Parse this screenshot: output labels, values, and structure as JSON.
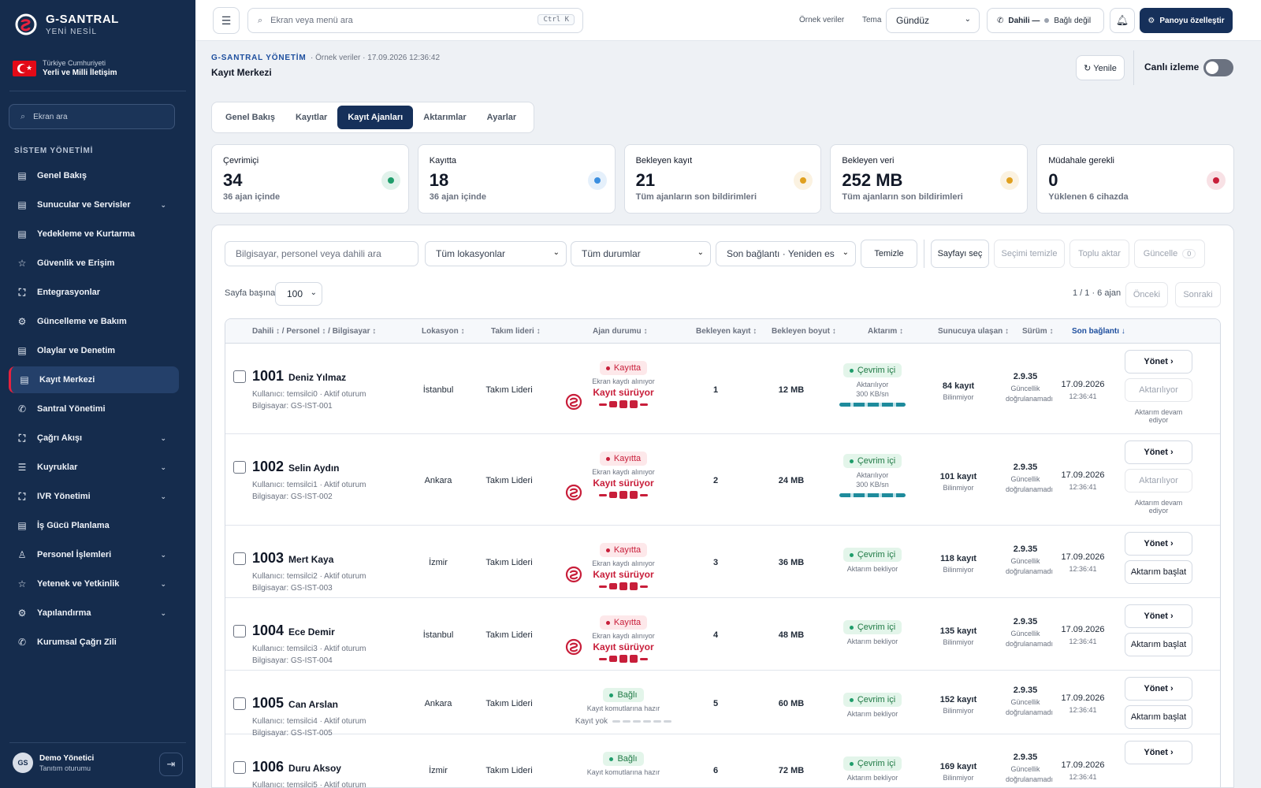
{
  "brand": {
    "name": "G-SANTRAL",
    "sub": "YENİ NESİL",
    "flag_line1": "Türkiye Cumhuriyeti",
    "flag_line2": "Yerli ve Milli İletişim"
  },
  "sidebar": {
    "search_placeholder": "Ekran ara",
    "section_title": "SİSTEM YÖNETİMİ",
    "items": [
      {
        "label": "Genel Bakış",
        "icon": "dashboard-icon",
        "chevron": false
      },
      {
        "label": "Sunucular ve Servisler",
        "icon": "server-icon",
        "chevron": true
      },
      {
        "label": "Yedekleme ve Kurtarma",
        "icon": "backup-icon",
        "chevron": false
      },
      {
        "label": "Güvenlik ve Erişim",
        "icon": "star-icon",
        "chevron": false
      },
      {
        "label": "Entegrasyonlar",
        "icon": "integration-icon",
        "chevron": false
      },
      {
        "label": "Güncelleme ve Bakım",
        "icon": "gear-icon",
        "chevron": false
      },
      {
        "label": "Olaylar ve Denetim",
        "icon": "audit-icon",
        "chevron": false
      },
      {
        "label": "Kayıt Merkezi",
        "icon": "record-icon",
        "chevron": false,
        "active": true
      },
      {
        "label": "Santral Yönetimi",
        "icon": "phone-icon",
        "chevron": false
      },
      {
        "label": "Çağrı Akışı",
        "icon": "flow-icon",
        "chevron": true
      },
      {
        "label": "Kuyruklar",
        "icon": "queue-icon",
        "chevron": true
      },
      {
        "label": "IVR Yönetimi",
        "icon": "ivr-icon",
        "chevron": true
      },
      {
        "label": "İş Gücü Planlama",
        "icon": "planning-icon",
        "chevron": false
      },
      {
        "label": "Personel İşlemleri",
        "icon": "person-icon",
        "chevron": true
      },
      {
        "label": "Yetenek ve Yetkinlik",
        "icon": "star-icon",
        "chevron": true
      },
      {
        "label": "Yapılandırma",
        "icon": "gear-icon",
        "chevron": true
      },
      {
        "label": "Kurumsal Çağrı Zili",
        "icon": "phone-icon",
        "chevron": false
      }
    ],
    "user": {
      "initials": "GS",
      "name": "Demo Yönetici",
      "session": "Tanıtım oturumu"
    }
  },
  "topbar": {
    "search_placeholder": "Ekran veya menü ara",
    "shortcut": "Ctrl K",
    "sample_data": "Örnek veriler",
    "theme_label": "Tema",
    "theme_value": "Gündüz",
    "dahili_label": "Dahili —",
    "dahili_status": "Bağlı değil",
    "customize": "Panoyu özelleştir"
  },
  "header": {
    "crumb_brand": "G-SANTRAL YÖNETİM",
    "crumb_rest": "· Örnek veriler · 17.09.2026 12:36:42",
    "title": "Kayıt Merkezi",
    "refresh": "↻ Yenile",
    "live_label": "Canlı izleme",
    "live_on": false
  },
  "tabs": [
    {
      "label": "Genel Bakış"
    },
    {
      "label": "Kayıtlar"
    },
    {
      "label": "Kayıt Ajanları",
      "active": true
    },
    {
      "label": "Aktarımlar"
    },
    {
      "label": "Ayarlar"
    }
  ],
  "stats": [
    {
      "label": "Çevrimiçi",
      "value": "34",
      "sub": "36 ajan içinde",
      "color": "#1f9d6b"
    },
    {
      "label": "Kayıtta",
      "value": "18",
      "sub": "36 ajan içinde",
      "color": "#3b8fe0"
    },
    {
      "label": "Bekleyen kayıt",
      "value": "21",
      "sub": "Tüm ajanların son bildirimleri",
      "color": "#e0a01f"
    },
    {
      "label": "Bekleyen veri",
      "value": "252 MB",
      "sub": "Tüm ajanların son bildirimleri",
      "color": "#e0a01f"
    },
    {
      "label": "Müdahale gerekli",
      "value": "0",
      "sub": "Yüklenen 6 cihazda",
      "color": "#c81e3a"
    }
  ],
  "filters": {
    "search_placeholder": "Bilgisayar, personel veya dahili ara",
    "location": "Tüm lokasyonlar",
    "status": "Tüm durumlar",
    "sort": "Son bağlantı · Yeniden es",
    "clear": "Temizle",
    "select_page": "Sayfayı seç",
    "clear_selection": "Seçimi temizle",
    "bulk_transfer": "Toplu aktar",
    "update": "Güncelle",
    "update_count": "0",
    "per_page_label": "Sayfa başına",
    "per_page": "100",
    "count": "1 / 1 · 6 ajan",
    "prev": "Önceki",
    "next": "Sonraki"
  },
  "columns": {
    "dahili": "Dahili ↕ / Personel ↕ / Bilgisayar ↕",
    "lokasyon": "Lokasyon ↕",
    "takim": "Takım lideri ↕",
    "ajan": "Ajan durumu ↕",
    "bekleyen_kayit": "Bekleyen kayıt ↕",
    "bekleyen_boyut": "Bekleyen boyut ↕",
    "aktarim": "Aktarım ↕",
    "sunucu": "Sunucuya ulaşan ↕",
    "surum": "Sürüm ↕",
    "son": "Son bağlantı ↓"
  },
  "rows": [
    {
      "ext": "1001",
      "name": "Deniz Yılmaz",
      "user": "Kullanıcı: temsilci0 · Aktif oturum",
      "pc": "Bilgisayar: GS-IST-001",
      "location": "İstanbul",
      "lead": "Takım Lideri",
      "agent_pill": "Kayıtta",
      "agent_note": "Ekran kaydı alınıyor",
      "rec_text": "Kayıt sürüyor",
      "recording": true,
      "pending": "1",
      "size": "12 MB",
      "transfer": "Çevrim içi",
      "transfer_note": "Aktarılıyor",
      "speed": "300 KB/sn",
      "transferring": true,
      "server": "84 kayıt",
      "server_note": "Bilinmiyor",
      "version": "2.9.35",
      "version_note": "Güncellik doğrulanamadı",
      "date": "17.09.2026",
      "time": "12:36:41",
      "manage": "Yönet ›",
      "second": "Aktarılıyor",
      "second_disabled": true,
      "note": "Aktarım devam ediyor"
    },
    {
      "ext": "1002",
      "name": "Selin Aydın",
      "user": "Kullanıcı: temsilci1 · Aktif oturum",
      "pc": "Bilgisayar: GS-IST-002",
      "location": "Ankara",
      "lead": "Takım Lideri",
      "agent_pill": "Kayıtta",
      "agent_note": "Ekran kaydı alınıyor",
      "rec_text": "Kayıt sürüyor",
      "recording": true,
      "pending": "2",
      "size": "24 MB",
      "transfer": "Çevrim içi",
      "transfer_note": "Aktarılıyor",
      "speed": "300 KB/sn",
      "transferring": true,
      "server": "101 kayıt",
      "server_note": "Bilinmiyor",
      "version": "2.9.35",
      "version_note": "Güncellik doğrulanamadı",
      "date": "17.09.2026",
      "time": "12:36:41",
      "manage": "Yönet ›",
      "second": "Aktarılıyor",
      "second_disabled": true,
      "note": "Aktarım devam ediyor"
    },
    {
      "ext": "1003",
      "name": "Mert Kaya",
      "user": "Kullanıcı: temsilci2 · Aktif oturum",
      "pc": "Bilgisayar: GS-IST-003",
      "location": "İzmir",
      "lead": "Takım Lideri",
      "agent_pill": "Kayıtta",
      "agent_note": "Ekran kaydı alınıyor",
      "rec_text": "Kayıt sürüyor",
      "recording": true,
      "pending": "3",
      "size": "36 MB",
      "transfer": "Çevrim içi",
      "transfer_note": "Aktarım bekliyor",
      "speed": "",
      "transferring": false,
      "server": "118 kayıt",
      "server_note": "Bilinmiyor",
      "version": "2.9.35",
      "version_note": "Güncellik doğrulanamadı",
      "date": "17.09.2026",
      "time": "12:36:41",
      "manage": "Yönet ›",
      "second": "Aktarım başlat",
      "second_disabled": false,
      "note": ""
    },
    {
      "ext": "1004",
      "name": "Ece Demir",
      "user": "Kullanıcı: temsilci3 · Aktif oturum",
      "pc": "Bilgisayar: GS-IST-004",
      "location": "İstanbul",
      "lead": "Takım Lideri",
      "agent_pill": "Kayıtta",
      "agent_note": "Ekran kaydı alınıyor",
      "rec_text": "Kayıt sürüyor",
      "recording": true,
      "pending": "4",
      "size": "48 MB",
      "transfer": "Çevrim içi",
      "transfer_note": "Aktarım bekliyor",
      "speed": "",
      "transferring": false,
      "server": "135 kayıt",
      "server_note": "Bilinmiyor",
      "version": "2.9.35",
      "version_note": "Güncellik doğrulanamadı",
      "date": "17.09.2026",
      "time": "12:36:41",
      "manage": "Yönet ›",
      "second": "Aktarım başlat",
      "second_disabled": false,
      "note": ""
    },
    {
      "ext": "1005",
      "name": "Can Arslan",
      "user": "Kullanıcı: temsilci4 · Aktif oturum",
      "pc": "Bilgisayar: GS-IST-005",
      "location": "Ankara",
      "lead": "Takım Lideri",
      "agent_pill": "Bağlı",
      "agent_note": "Kayıt komutlarına hazır",
      "rec_text": "Kayıt yok",
      "recording": false,
      "pending": "5",
      "size": "60 MB",
      "transfer": "Çevrim içi",
      "transfer_note": "Aktarım bekliyor",
      "speed": "",
      "transferring": false,
      "server": "152 kayıt",
      "server_note": "Bilinmiyor",
      "version": "2.9.35",
      "version_note": "Güncellik doğrulanamadı",
      "date": "17.09.2026",
      "time": "12:36:41",
      "manage": "Yönet ›",
      "second": "Aktarım başlat",
      "second_disabled": false,
      "note": ""
    },
    {
      "ext": "1006",
      "name": "Duru Aksoy",
      "user": "Kullanıcı: temsilci5 · Aktif oturum",
      "pc": "",
      "location": "İzmir",
      "lead": "Takım Lideri",
      "agent_pill": "Bağlı",
      "agent_note": "Kayıt komutlarına hazır",
      "rec_text": "",
      "recording": false,
      "pending": "6",
      "size": "72 MB",
      "transfer": "Çevrim içi",
      "transfer_note": "Aktarım bekliyor",
      "speed": "",
      "transferring": false,
      "server": "169 kayıt",
      "server_note": "Bilinmiyor",
      "version": "2.9.35",
      "version_note": "Güncellik doğrulanamadı",
      "date": "17.09.2026",
      "time": "12:36:41",
      "manage": "Yönet ›",
      "second": "",
      "second_disabled": false,
      "note": ""
    }
  ]
}
